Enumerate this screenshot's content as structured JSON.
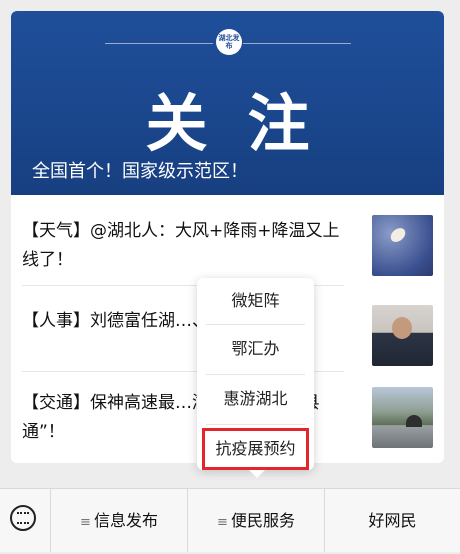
{
  "banner": {
    "logo_text": "湖北发布",
    "title": "关注",
    "subtitle": "全国首个！国家级示范区！"
  },
  "articles": [
    {
      "text": "【天气】@湖北人：大风+降雨+降温又上线了！",
      "thumb": "weather-thumbnail"
    },
    {
      "text": "【人事】刘德富任湖…、彭育园任校长",
      "thumb": "official-portrait-thumbnail"
    },
    {
      "text": "【交通】保神高速最…湖北将实现“县县通”！",
      "thumb": "highway-tunnel-thumbnail"
    }
  ],
  "popup_menu": {
    "items": [
      "微矩阵",
      "鄂汇办",
      "惠游湖北",
      "抗疫展预约"
    ],
    "highlight_color": "#e2262c"
  },
  "tabbar": {
    "keyboard_icon": "keyboard-icon",
    "tabs": [
      "信息发布",
      "便民服务",
      "好网民"
    ]
  }
}
